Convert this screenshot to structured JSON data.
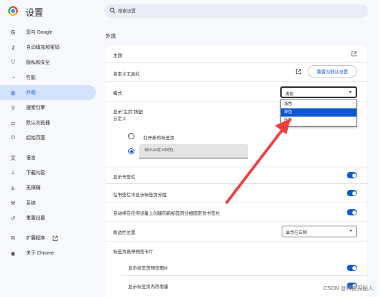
{
  "app": {
    "title": "设置"
  },
  "search": {
    "placeholder": "搜索设置"
  },
  "sidebar": {
    "items": [
      {
        "label": "您与 Google",
        "icon": "google-icon"
      },
      {
        "label": "自动填充和密码",
        "icon": "key-icon"
      },
      {
        "label": "隐私和安全",
        "icon": "shield-icon"
      },
      {
        "label": "性能",
        "icon": "speedometer-icon"
      },
      {
        "label": "外观",
        "icon": "palette-icon",
        "active": true
      },
      {
        "label": "搜索引擎",
        "icon": "search-icon"
      },
      {
        "label": "默认浏览器",
        "icon": "browser-window-icon"
      },
      {
        "label": "起始页面",
        "icon": "power-icon"
      },
      {
        "label": "语言",
        "icon": "translate-icon"
      },
      {
        "label": "下载内容",
        "icon": "download-icon"
      },
      {
        "label": "无障碍",
        "icon": "accessibility-icon"
      },
      {
        "label": "系统",
        "icon": "wrench-icon"
      },
      {
        "label": "重置设置",
        "icon": "reset-icon"
      },
      {
        "label": "扩展程序",
        "icon": "puzzle-icon"
      },
      {
        "label": "关于 Chrome",
        "icon": "chrome-icon"
      }
    ]
  },
  "main": {
    "section_title": "外观",
    "theme": {
      "label": "主题"
    },
    "toolbar": {
      "label": "自定义工具栏",
      "reset_button": "重置为默认设置"
    },
    "mode": {
      "label": "模式",
      "selected": "浅色",
      "options": [
        "浅色",
        "深色",
        "设备"
      ],
      "highlighted": "深色"
    },
    "home_button": {
      "label": "显示“主页”按钮",
      "sublabel": "自定义",
      "option_new_tab": "打开新的标签页",
      "custom_url_placeholder": "输入自定义网址"
    },
    "show_bookmarks_bar": "显示书签栏",
    "show_tab_groups": "在书签栏中显示标签页分组",
    "auto_pin_groups": "自动将在任何设备上创建的新标签页分组固定到书签栏",
    "side_panel": {
      "label": "侧边栏位置",
      "selected": "显示在右侧"
    },
    "tab_hover": {
      "label": "标签页悬停预览卡片"
    },
    "show_tab_preview_image": "显示标签页预览图片",
    "show_tab_memory": "显示标签页内存用量"
  },
  "watermark": "CSDN @科技探秘人",
  "colors": {
    "accent": "#0b57d0",
    "active_nav_bg": "#d3e3fd",
    "arrow": "#f03c3c"
  }
}
